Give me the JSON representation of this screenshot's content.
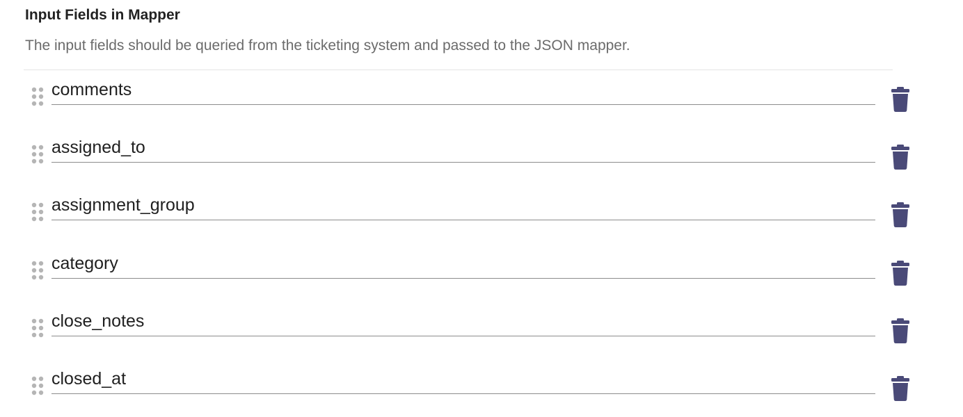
{
  "section": {
    "title": "Input Fields in Mapper",
    "description": "The input fields should be queried from the ticketing system and passed to the JSON mapper."
  },
  "fields": [
    {
      "value": "comments",
      "drag_icon": "drag-handle-icon",
      "delete_icon": "trash-icon"
    },
    {
      "value": "assigned_to",
      "drag_icon": "drag-handle-icon",
      "delete_icon": "trash-icon"
    },
    {
      "value": "assignment_group",
      "drag_icon": "drag-handle-icon",
      "delete_icon": "trash-icon"
    },
    {
      "value": "category",
      "drag_icon": "drag-handle-icon",
      "delete_icon": "trash-icon"
    },
    {
      "value": "close_notes",
      "drag_icon": "drag-handle-icon",
      "delete_icon": "trash-icon"
    },
    {
      "value": "closed_at",
      "drag_icon": "drag-handle-icon",
      "delete_icon": "trash-icon"
    }
  ],
  "colors": {
    "delete_icon": "#4a4a78",
    "drag_handle": "#b5b5b5",
    "underline": "#8c8c8c",
    "title": "#222222",
    "description": "#6b6b6b"
  }
}
